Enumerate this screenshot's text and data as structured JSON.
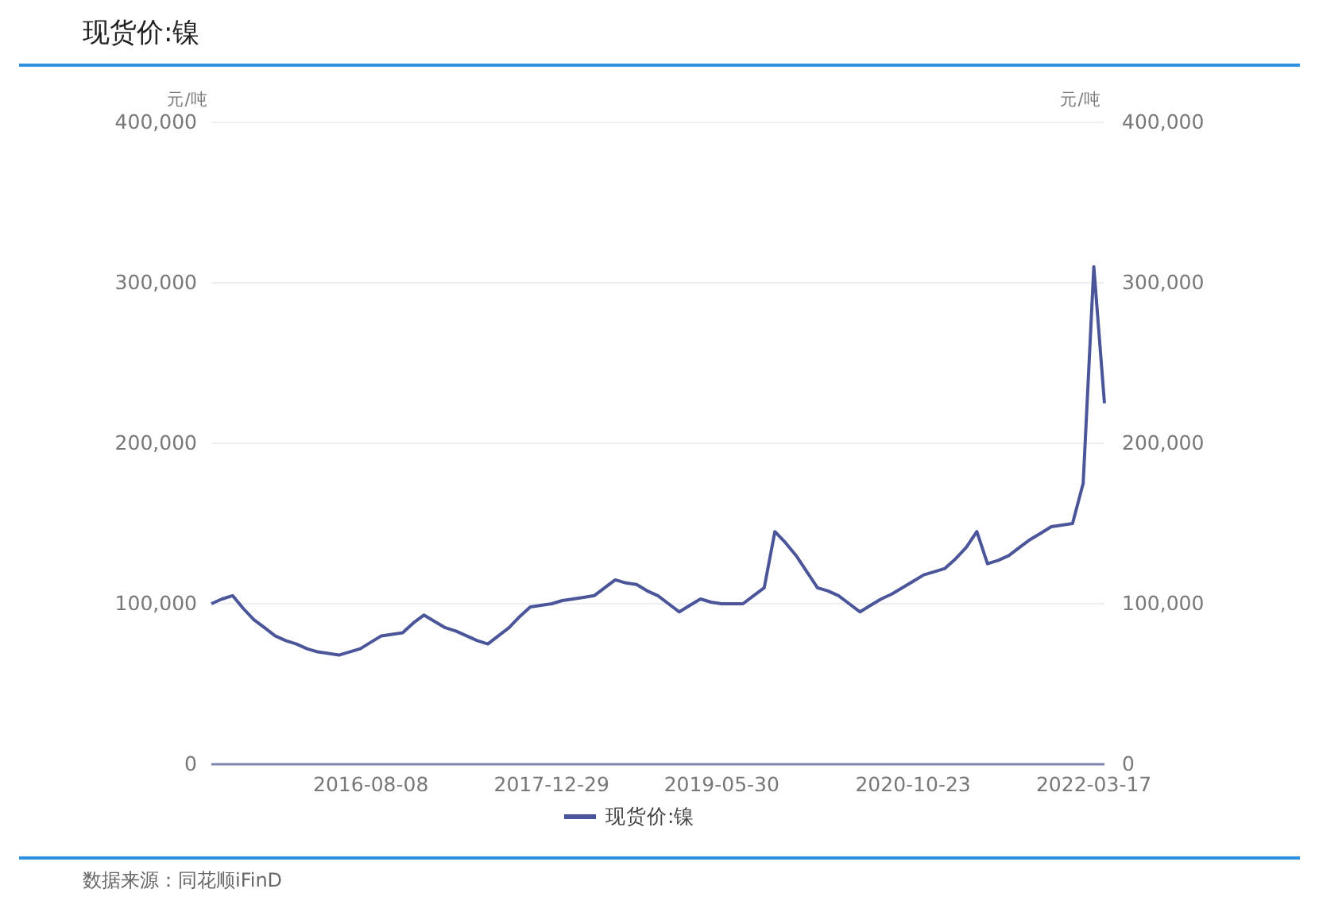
{
  "title": "现货价:镍",
  "chart": {
    "left_unit": "元/吨",
    "right_unit": "元/吨",
    "right_yticks": [
      "400,000",
      "300,000",
      "200,000",
      "100,000",
      "0"
    ],
    "chart_data": {
      "type": "line",
      "categories": [
        null,
        null,
        null,
        null,
        null,
        null,
        null,
        null,
        null,
        null,
        null,
        null,
        null,
        null,
        null,
        "2016-08-08",
        null,
        null,
        null,
        null,
        null,
        null,
        null,
        null,
        null,
        null,
        null,
        null,
        null,
        null,
        null,
        null,
        "2017-12-29",
        null,
        null,
        null,
        null,
        null,
        null,
        null,
        null,
        null,
        null,
        null,
        null,
        null,
        null,
        null,
        "2019-05-30",
        null,
        null,
        null,
        null,
        null,
        null,
        null,
        null,
        null,
        null,
        null,
        null,
        null,
        null,
        null,
        null,
        null,
        "2020-10-23",
        null,
        null,
        null,
        null,
        null,
        null,
        null,
        null,
        null,
        null,
        null,
        null,
        null,
        null,
        null,
        null,
        "2022-03-17",
        null
      ],
      "series": [
        {
          "name": "现货价:镍",
          "color": "#4a5699",
          "values": [
            100000,
            103000,
            105000,
            97000,
            90000,
            85000,
            80000,
            77000,
            75000,
            72000,
            70000,
            69000,
            68000,
            70000,
            72000,
            76000,
            80000,
            81000,
            82000,
            88000,
            93000,
            89000,
            85000,
            83000,
            80000,
            77000,
            75000,
            80000,
            85000,
            92000,
            98000,
            99000,
            100000,
            102000,
            103000,
            104000,
            105000,
            110000,
            115000,
            113000,
            112000,
            108000,
            105000,
            100000,
            95000,
            99000,
            103000,
            101000,
            100000,
            100000,
            100000,
            105000,
            110000,
            145000,
            138000,
            130000,
            120000,
            110000,
            108000,
            105000,
            100000,
            95000,
            99000,
            103000,
            106000,
            110000,
            114000,
            118000,
            120000,
            122000,
            128000,
            135000,
            145000,
            125000,
            127000,
            130000,
            135000,
            140000,
            144000,
            148000,
            149000,
            150000,
            175000,
            310000,
            225000
          ]
        }
      ],
      "ylim": [
        0,
        400000
      ],
      "grid": true,
      "yticks": [
        {
          "value": 0,
          "label": "0"
        },
        {
          "value": 100000,
          "label": "100,000"
        },
        {
          "value": 200000,
          "label": "200,000"
        },
        {
          "value": 300000,
          "label": "300,000"
        },
        {
          "value": 400000,
          "label": "400,000"
        }
      ]
    }
  },
  "source": "数据来源：同花顺iFinD"
}
